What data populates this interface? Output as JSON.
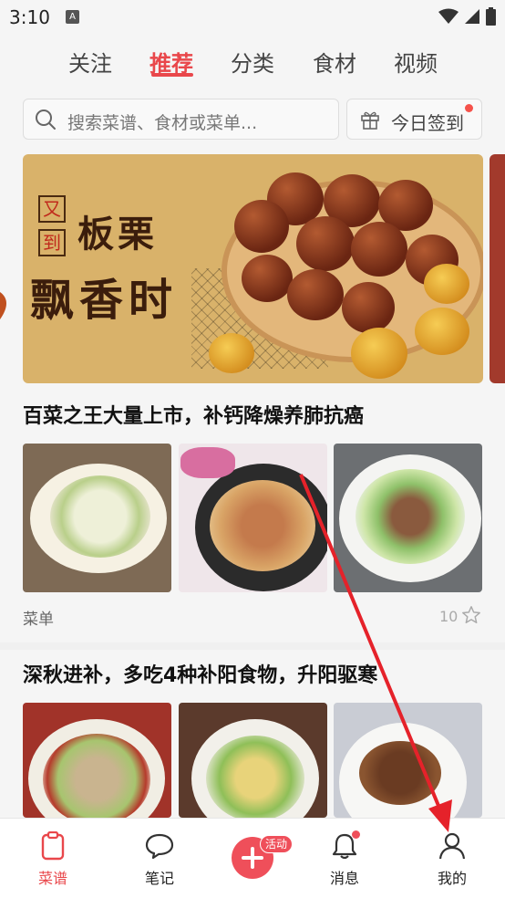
{
  "status_bar": {
    "time": "3:10",
    "notification_icon": "A"
  },
  "tabs": [
    {
      "label": "关注",
      "active": false
    },
    {
      "label": "推荐",
      "active": true
    },
    {
      "label": "分类",
      "active": false
    },
    {
      "label": "食材",
      "active": false
    },
    {
      "label": "视频",
      "active": false
    }
  ],
  "search": {
    "placeholder": "搜索菜谱、食材或菜单..."
  },
  "checkin": {
    "label": "今日签到"
  },
  "banner": {
    "tag1": "又",
    "tag2": "到",
    "title_line1": "板栗",
    "title_line2": "飘香时"
  },
  "section1": {
    "title": "百菜之王大量上市，补钙降燥养肺抗癌",
    "caption": "菜单",
    "likes": "10"
  },
  "section2": {
    "title": "深秋进补，多吃4种补阳食物，升阳驱寒"
  },
  "bottom_nav": {
    "recipes": "菜谱",
    "notes": "笔记",
    "activity_badge": "活动",
    "messages": "消息",
    "mine": "我的"
  },
  "colors": {
    "accent": "#e9474b"
  }
}
